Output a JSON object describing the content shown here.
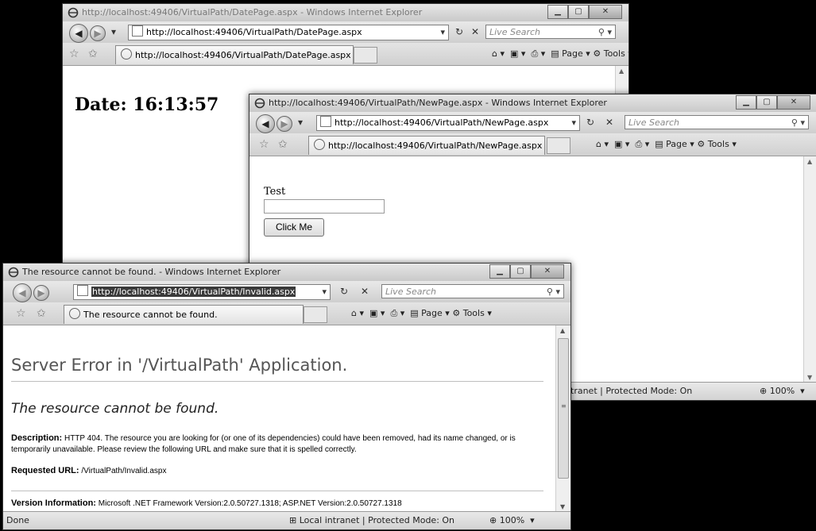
{
  "win1": {
    "title": "http://localhost:49406/VirtualPath/DatePage.aspx - Windows Internet Explorer",
    "url": "http://localhost:49406/VirtualPath/DatePage.aspx",
    "search_placeholder": "Live Search",
    "tab_label": "http://localhost:49406/VirtualPath/DatePage.aspx",
    "date_text": "Date: 16:13:57"
  },
  "win2": {
    "title": "http://localhost:49406/VirtualPath/NewPage.aspx - Windows Internet Explorer",
    "url": "http://localhost:49406/VirtualPath/NewPage.aspx",
    "search_placeholder": "Live Search",
    "tab_label": "http://localhost:49406/VirtualPath/NewPage.aspx",
    "field_label": "Test",
    "field_value": "",
    "button_label": "Click Me",
    "status_text": "tranet | Protected Mode: On",
    "zoom": "100%"
  },
  "win3": {
    "title": "The resource cannot be found. - Windows Internet Explorer",
    "url": "http://localhost:49406/VirtualPath/Invalid.aspx",
    "search_placeholder": "Live Search",
    "tab_label": "The resource cannot be found.",
    "heading": "Server Error in '/VirtualPath' Application.",
    "subheading": "The resource cannot be found.",
    "desc_label": "Description:",
    "desc_text": "HTTP 404. The resource you are looking for (or one of its dependencies) could have been removed, had its name changed, or is temporarily unavailable.  Please review the following URL and make sure that it is spelled correctly.",
    "req_label": "Requested URL:",
    "req_text": "/VirtualPath/Invalid.aspx",
    "version_label": "Version Information:",
    "version_text": "Microsoft .NET Framework Version:2.0.50727.1318; ASP.NET Version:2.0.50727.1318",
    "status_left": "Done",
    "status_mid": "Local intranet | Protected Mode: On",
    "zoom": "100%"
  },
  "toolbar": {
    "page_label": "Page",
    "tools_label": "Tools"
  },
  "icons": [
    "ie-icon",
    "back-icon",
    "forward-icon",
    "refresh-icon",
    "stop-icon",
    "search-icon",
    "favorites-star-icon",
    "add-favorites-icon",
    "home-icon",
    "feeds-icon",
    "print-icon",
    "page-icon",
    "tools-icon",
    "zoom-icon",
    "intranet-icon"
  ]
}
